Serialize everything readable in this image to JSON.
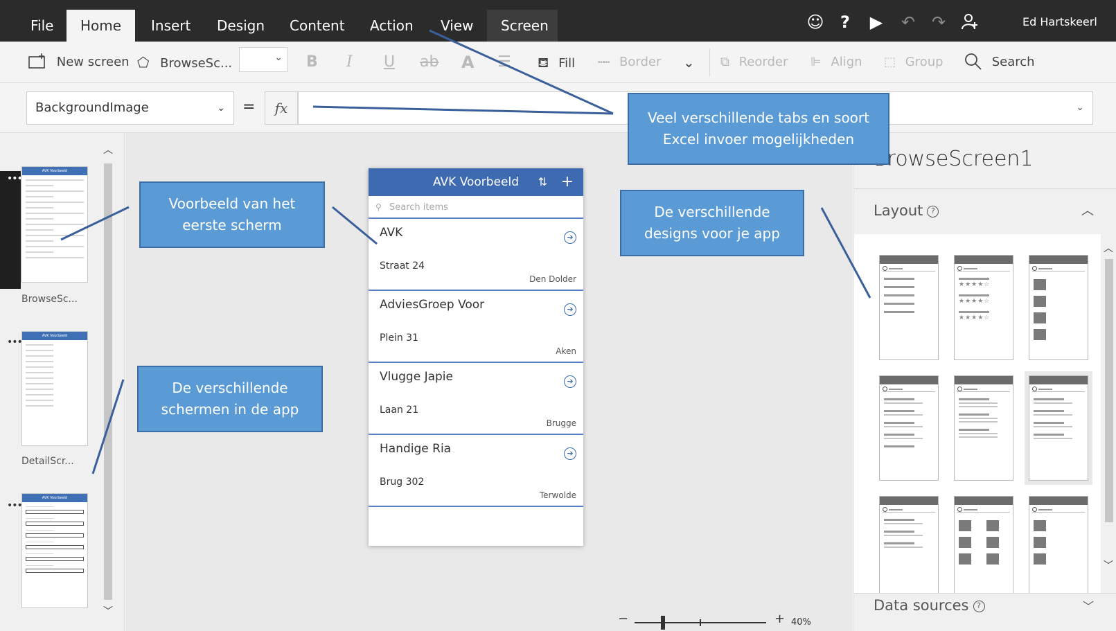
{
  "topbar": {
    "tabs": [
      "File",
      "Home",
      "Insert",
      "Design",
      "Content",
      "Action",
      "View",
      "Screen"
    ],
    "active_tab": "Home",
    "user_name": "Ed Hartskeerl",
    "icons": [
      "smiley-icon",
      "help-icon",
      "play-icon",
      "undo-icon",
      "redo-icon",
      "add-user-icon"
    ]
  },
  "ribbon": {
    "new_screen": "New screen",
    "browse_screen": "BrowseSc...",
    "bold": "B",
    "italic": "I",
    "underline": "U",
    "strike": "ab",
    "font_color": "A",
    "fill": "Fill",
    "border": "Border",
    "reorder": "Reorder",
    "align": "Align",
    "group": "Group",
    "search": "Search"
  },
  "formula": {
    "property": "BackgroundImage",
    "equals": "=",
    "fx": "fx",
    "value": ""
  },
  "screens": [
    {
      "label": "BrowseSc...",
      "header": "AVK Voorbeeld"
    },
    {
      "label": "DetailScr...",
      "header": "AVK Voorbeeld"
    },
    {
      "label": "",
      "header": "AVK Voorbeeld"
    }
  ],
  "phone": {
    "title": "AVK Voorbeeld",
    "search_placeholder": "Search items",
    "items": [
      {
        "title": "AVK",
        "subtitle": "Straat 24",
        "city": "Den Dolder"
      },
      {
        "title": "AdviesGroep Voor",
        "subtitle": "Plein 31",
        "city": "Aken"
      },
      {
        "title": "Vlugge Japie",
        "subtitle": "Laan 21",
        "city": "Brugge"
      },
      {
        "title": "Handige Ria",
        "subtitle": "Brug 302",
        "city": "Terwolde"
      }
    ]
  },
  "zoom": {
    "percent": "40%",
    "minus": "−",
    "plus": "+"
  },
  "right_panel": {
    "title": "BrowseScreen1",
    "layout_label": "Layout",
    "data_sources_label": "Data sources"
  },
  "callouts": {
    "tabs": "Veel verschillende tabs en soort\nExcel invoer mogelijkheden",
    "first_screen": "Voorbeeld van het\neerste scherm",
    "designs": "De verschillende\ndesigns voor je app",
    "screens": "De verschillende\nschermen in de app"
  },
  "colors": {
    "topbar": "#2b2b2b",
    "accent": "#3d6ab0",
    "callout_fill": "#5b9bd5",
    "callout_border": "#3a6ea8"
  }
}
